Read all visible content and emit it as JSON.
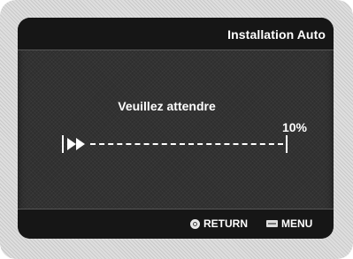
{
  "header": {
    "title": "Installation Auto"
  },
  "body": {
    "message": "Veuillez attendre",
    "progress_label": "10%",
    "progress_value": 0.1
  },
  "footer": {
    "return_label": "RETURN",
    "menu_label": "MENU"
  },
  "icons": {
    "return": "return-icon",
    "menu": "menu-icon",
    "progress": "fast-forward-icon"
  },
  "colors": {
    "text": "#ffffff",
    "background": "#2e2e2e",
    "bar": "#161616"
  }
}
